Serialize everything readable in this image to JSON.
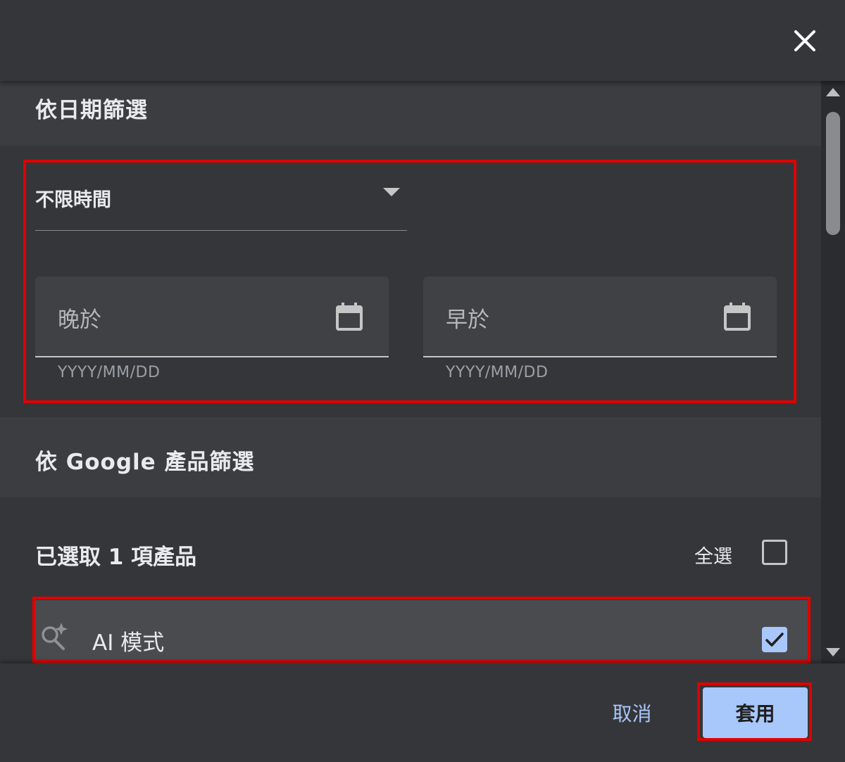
{
  "date_filter": {
    "title": "依日期篩選",
    "range_select": {
      "value": "不限時間"
    },
    "after_field": {
      "placeholder": "晚於",
      "hint": "YYYY/MM/DD"
    },
    "before_field": {
      "placeholder": "早於",
      "hint": "YYYY/MM/DD"
    }
  },
  "product_filter": {
    "title": "依 Google 產品篩選",
    "selected_count": "已選取 1 項產品",
    "select_all_label": "全選",
    "select_all_checked": false,
    "items": [
      {
        "label": "AI 模式",
        "icon": "ai-search-sparkle-icon",
        "checked": true
      }
    ]
  },
  "footer": {
    "cancel_label": "取消",
    "apply_label": "套用"
  },
  "colors": {
    "background": "#35363a",
    "section_header": "#3c3d41",
    "accent": "#a8c7fa",
    "highlight_box": "#e00000"
  }
}
